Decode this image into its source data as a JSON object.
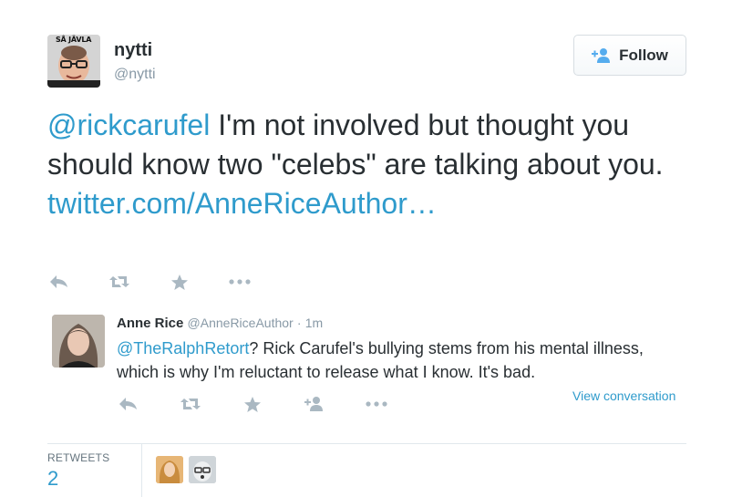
{
  "tweet": {
    "author": {
      "name": "nytti",
      "handle": "@nytti",
      "avatar_badge": "SÅ JÄVLA"
    },
    "follow_label": "Follow",
    "text": {
      "mention": "@rickcarufel",
      "body": " I'm not involved but thought you should know two \"celebs\" are talking about you.",
      "link": "twitter.com/AnneRiceAuthor…"
    },
    "actions": [
      "reply-icon",
      "retweet-icon",
      "favorite-icon",
      "more-icon"
    ]
  },
  "quoted": {
    "name": "Anne Rice",
    "handle": "@AnneRiceAuthor",
    "separator": "·",
    "time": "1m",
    "mention": "@TheRalphRetort",
    "body": "? Rick Carufel's bullying stems from his mental illness, which is why I'm reluctant to release what I know. It's bad.",
    "view_conversation": "View conversation",
    "actions": [
      "reply-icon",
      "retweet-icon",
      "favorite-icon",
      "follow-user-icon",
      "more-icon"
    ]
  },
  "stats": {
    "retweets_label": "RETWEETS",
    "retweets_count": "2"
  },
  "colors": {
    "link": "#2f9bcc",
    "text": "#292f33",
    "muted": "#8899a6",
    "icon": "#aab8c2",
    "border": "#e1e8ed"
  }
}
